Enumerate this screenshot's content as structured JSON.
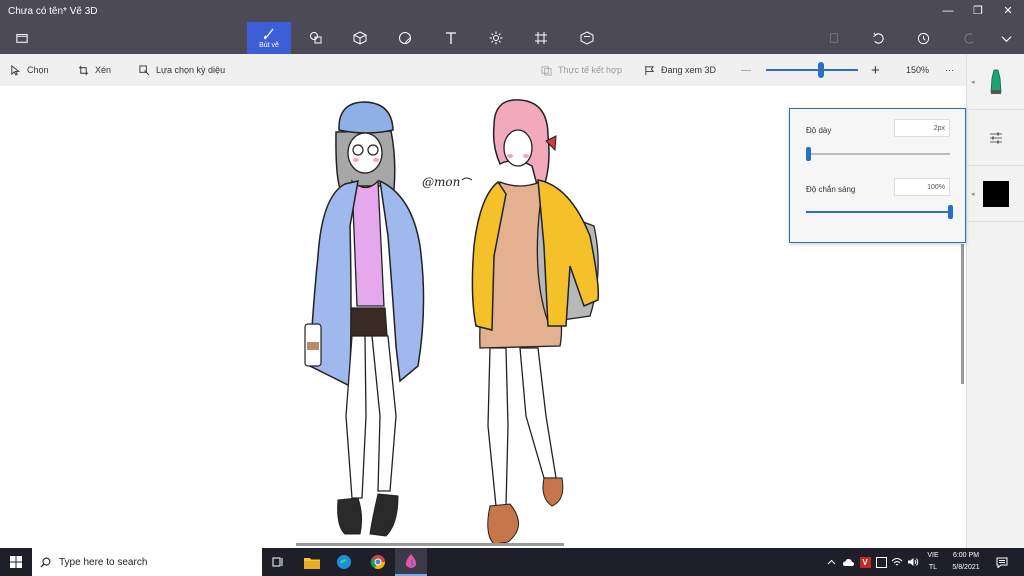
{
  "window": {
    "title": "Chưa có tên*   Vẽ 3D",
    "minimize": "—",
    "restore": "❐",
    "close": "✕"
  },
  "ribbon": {
    "active_tool_label": "Bút vẽ",
    "tools": [
      "brushes-icon",
      "shapes-2d-icon",
      "shapes-3d-icon",
      "stickers-icon",
      "text-icon",
      "effects-icon",
      "canvas-icon",
      "3d-library-icon"
    ]
  },
  "toolbar": {
    "select": "Chọn",
    "crop": "Xén",
    "magic_select": "Lựa chọn kỳ diệu",
    "mixed_reality": "Thực tế kết hợp",
    "view_3d": "Đang xem 3D",
    "zoom_out": "—",
    "zoom_in": "+",
    "zoom_percent": "150%",
    "more": "···",
    "zoom_value": 0.6
  },
  "brush_settings": {
    "thickness_label": "Độ dày",
    "thickness_value": "2px",
    "thickness_level": 0.02,
    "opacity_label": "Độ chắn sáng",
    "opacity_value": "100%",
    "opacity_level": 1.0
  },
  "canvas": {
    "signature_text": "@mon"
  },
  "side_panel": {
    "color": "#000000",
    "marker_color": "#1fa371"
  },
  "taskbar": {
    "search_placeholder": "Type here to search",
    "language_line1": "VIE",
    "language_line2": "TL",
    "time": "6:00 PM",
    "date": "5/8/2021"
  }
}
